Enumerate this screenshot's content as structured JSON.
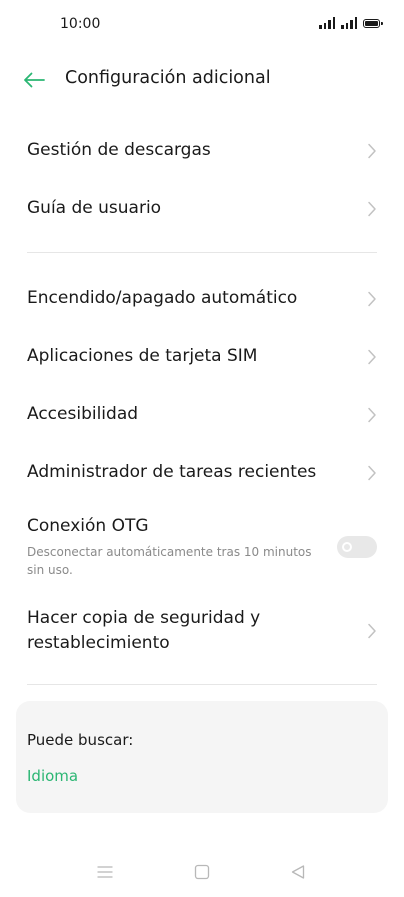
{
  "status_bar": {
    "time": "10:00",
    "icons": [
      "signal-icon",
      "signal-icon",
      "battery-icon"
    ]
  },
  "header": {
    "title": "Configuración adicional",
    "back_icon": "arrow-left-icon",
    "accent_color": "#2bb673"
  },
  "groups": [
    {
      "items": [
        {
          "label": "Gestión de descargas",
          "type": "link"
        },
        {
          "label": "Guía de usuario",
          "type": "link"
        }
      ]
    },
    {
      "items": [
        {
          "label": "Encendido/apagado automático",
          "type": "link"
        },
        {
          "label": "Aplicaciones de tarjeta SIM",
          "type": "link"
        },
        {
          "label": "Accesibilidad",
          "type": "link"
        },
        {
          "label": "Administrador de tareas recientes",
          "type": "link"
        },
        {
          "label": "Conexión OTG",
          "type": "toggle",
          "description": "Desconectar automáticamente tras 10 minutos sin uso.",
          "enabled": false
        },
        {
          "label": "Hacer copia de seguridad y restablecimiento",
          "type": "link"
        }
      ]
    }
  ],
  "search_suggestions": {
    "title": "Puede buscar:",
    "items": [
      "Idioma"
    ]
  },
  "nav_bar": {
    "icons": [
      "menu-icon",
      "home-square-icon",
      "back-triangle-icon"
    ]
  }
}
